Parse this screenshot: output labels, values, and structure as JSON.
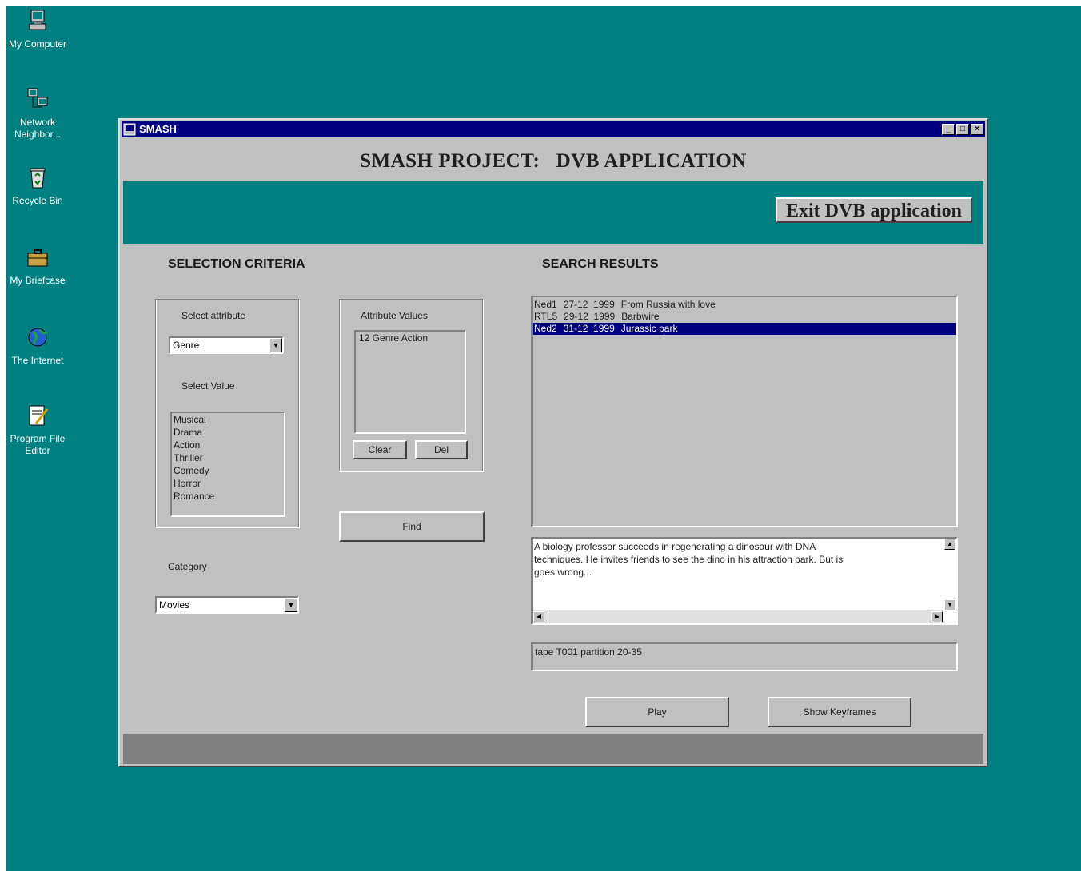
{
  "desktop": {
    "background": "#008080",
    "icons": [
      {
        "label": "My Computer",
        "icon": "computer-icon"
      },
      {
        "label": "Network Neighbor...",
        "icon": "network-icon"
      },
      {
        "label": "Recycle Bin",
        "icon": "recycle-bin-icon"
      },
      {
        "label": "My Briefcase",
        "icon": "briefcase-icon"
      },
      {
        "label": "The Internet",
        "icon": "internet-icon"
      },
      {
        "label": "Program File Editor",
        "icon": "file-editor-icon"
      }
    ]
  },
  "window": {
    "title": "SMASH",
    "controls": {
      "minimize": "_",
      "maximize": "□",
      "close": "×"
    },
    "titlebar_color": "#000080"
  },
  "header": {
    "title": "SMASH PROJECT:   DVB APPLICATION",
    "exit_button": "Exit DVB application"
  },
  "selection": {
    "heading": "SELECTION CRITERIA",
    "select_attribute_label": "Select attribute",
    "attribute_value": "Genre",
    "select_value_label": "Select Value",
    "values": [
      "Musical",
      "Drama",
      "Action",
      "Thriller",
      "Comedy",
      "Horror",
      "Romance"
    ],
    "attribute_values_label": "Attribute Values",
    "attribute_values": [
      "12  Genre  Action"
    ],
    "clear_button": "Clear",
    "del_button": "Del",
    "find_button": "Find",
    "category_label": "Category",
    "category_value": "Movies"
  },
  "results": {
    "heading": "SEARCH RESULTS",
    "rows": [
      {
        "channel": "Ned1",
        "date": "27-12  1999",
        "title": "From Russia with love",
        "selected": false
      },
      {
        "channel": "RTL5",
        "date": "29-12  1999",
        "title": "Barbwire",
        "selected": false
      },
      {
        "channel": "Ned2",
        "date": "31-12  1999",
        "title": "Jurassic park",
        "selected": true
      }
    ],
    "description": "A biology professor succeeds in regenerating a dinosaur with DNA techniques. He invites friends to see the dino in his attraction park. But is goes wrong...",
    "tape_info": "tape T001 partition 20-35",
    "play_button": "Play",
    "keyframes_button": "Show Keyframes"
  }
}
